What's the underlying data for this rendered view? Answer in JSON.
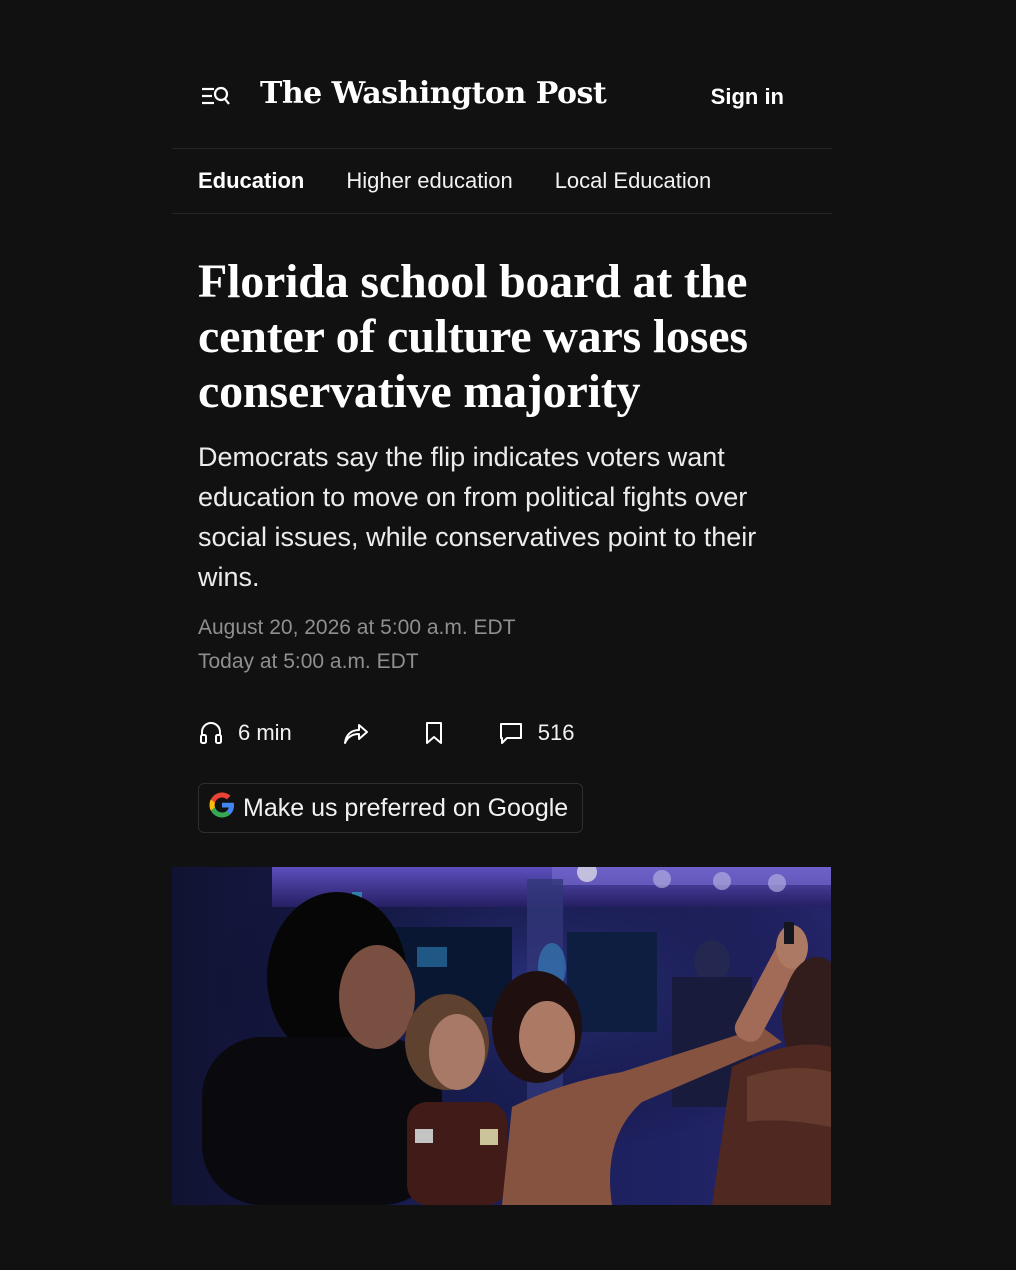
{
  "header": {
    "logo_text": "The Washington Post",
    "sign_in_label": "Sign in",
    "menu_icon": "menu-search-icon"
  },
  "section_nav": {
    "items": [
      {
        "label": "Education",
        "active": true
      },
      {
        "label": "Higher education",
        "active": false
      },
      {
        "label": "Local Education",
        "active": false
      }
    ]
  },
  "article": {
    "headline": "Florida school board at the center of culture wars loses conservative majority",
    "dek": "Democrats say the flip indicates voters want education to move on from political fights over social issues, while conservatives point to their wins.",
    "published": "August 20, 2026 at 5:00 a.m. EDT",
    "updated": "Today at 5:00 a.m. EDT",
    "actions": {
      "listen_label": "6 min",
      "comments_count": "516",
      "icons": [
        "headphones-icon",
        "share-icon",
        "bookmark-icon",
        "comment-icon"
      ]
    },
    "google_button_label": "Make us preferred on Google"
  },
  "colors": {
    "background": "#111111",
    "text": "#ffffff",
    "muted": "#8f8f8f",
    "divider": "#262626"
  }
}
